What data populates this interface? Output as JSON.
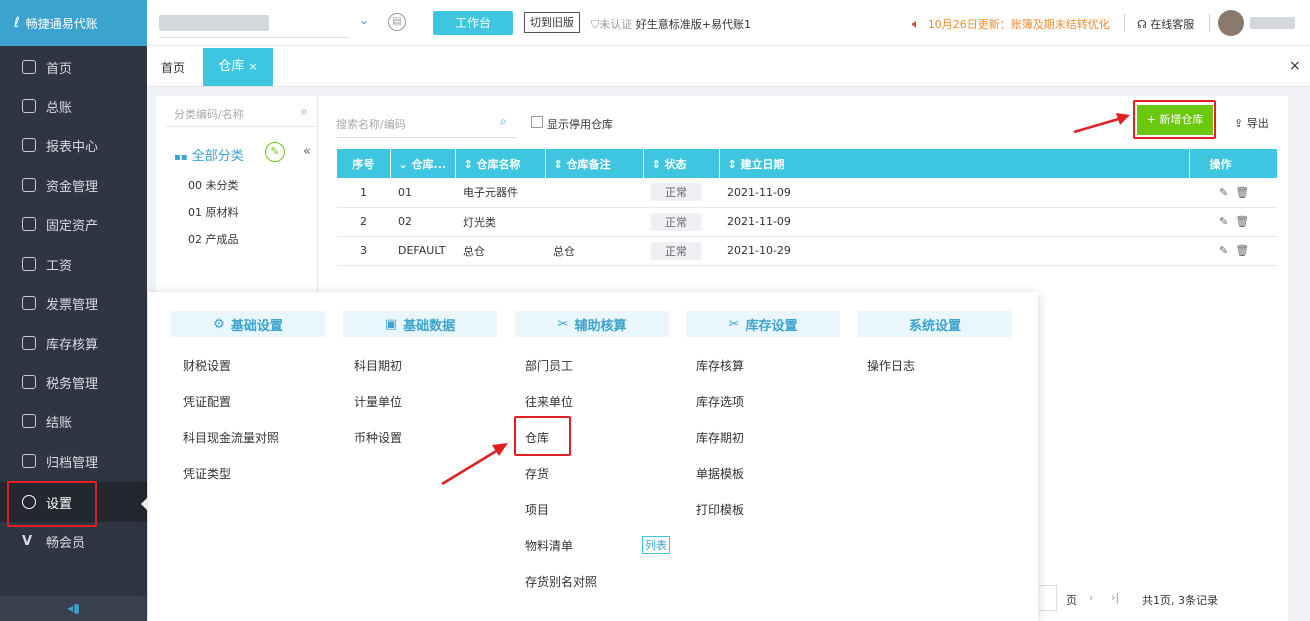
{
  "app": {
    "logo_text": "畅捷通易代账"
  },
  "sidebar": {
    "items": [
      {
        "label": "首页",
        "icon": "home-icon"
      },
      {
        "label": "总账",
        "icon": "ledger-icon"
      },
      {
        "label": "报表中心",
        "icon": "chart-icon"
      },
      {
        "label": "资金管理",
        "icon": "money-icon"
      },
      {
        "label": "固定资产",
        "icon": "asset-icon"
      },
      {
        "label": "工资",
        "icon": "salary-icon"
      },
      {
        "label": "发票管理",
        "icon": "invoice-icon"
      },
      {
        "label": "库存核算",
        "icon": "warehouse-icon"
      },
      {
        "label": "税务管理",
        "icon": "tax-icon"
      },
      {
        "label": "结账",
        "icon": "close-account-icon"
      },
      {
        "label": "归档管理",
        "icon": "archive-icon"
      },
      {
        "label": "设置",
        "icon": "gear-icon"
      },
      {
        "label": "畅会员",
        "icon": "vip-icon"
      }
    ],
    "active": "设置"
  },
  "header": {
    "workbench": "工作台",
    "switch_old": "切到旧版",
    "cert": "未认证",
    "edition": "好生意标准版+易代账1",
    "update": "10月26日更新：账簿及期末结转优化",
    "service": "在线客服"
  },
  "tabs": {
    "home": "首页",
    "current": "仓库"
  },
  "tree": {
    "search_placeholder": "分类编码/名称",
    "root": "全部分类",
    "nodes": [
      "00 未分类",
      "01 原材料",
      "02 产成品"
    ]
  },
  "toolbar": {
    "search_placeholder": "搜索名称/编码",
    "show_disabled": "显示停用仓库",
    "add": "+ 新增仓库",
    "export": "导出"
  },
  "table": {
    "headers": [
      "序号",
      "仓库...",
      "仓库名称",
      "仓库备注",
      "状态",
      "建立日期",
      "操作"
    ],
    "rows": [
      {
        "no": "1",
        "code": "01",
        "name": "电子元器件",
        "remark": "",
        "status": "正常",
        "date": "2021-11-09"
      },
      {
        "no": "2",
        "code": "02",
        "name": "灯光类",
        "remark": "",
        "status": "正常",
        "date": "2021-11-09"
      },
      {
        "no": "3",
        "code": "DEFAULT",
        "name": "总仓",
        "remark": "总仓",
        "status": "正常",
        "date": "2021-10-29"
      }
    ]
  },
  "menu": {
    "columns": [
      {
        "title": "基础设置",
        "items": [
          "财税设置",
          "凭证配置",
          "科目现金流量对照",
          "凭证类型"
        ]
      },
      {
        "title": "基础数据",
        "items": [
          "科目期初",
          "计量单位",
          "币种设置"
        ]
      },
      {
        "title": "辅助核算",
        "items": [
          "部门员工",
          "往来单位",
          "仓库",
          "存货",
          "项目",
          "物料清单",
          "存货别名对照"
        ]
      },
      {
        "title": "库存设置",
        "items": [
          "库存核算",
          "库存选项",
          "库存期初",
          "单据模板",
          "打印模板"
        ]
      },
      {
        "title": "系统设置",
        "items": [
          "操作日志"
        ]
      }
    ],
    "list_badge": "列表"
  },
  "pager": {
    "page_label": "页",
    "summary": "共1页, 3条记录"
  }
}
